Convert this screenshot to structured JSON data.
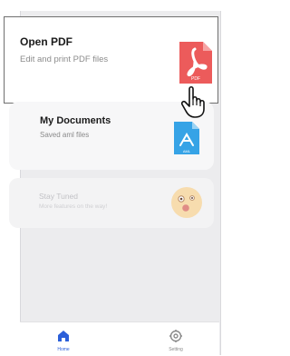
{
  "cards": {
    "open_pdf": {
      "title": "Open PDF",
      "subtitle": "Edit and print PDF files",
      "icon": "pdf-file-icon",
      "badge": "PDF"
    },
    "my_documents": {
      "title": "My Documents",
      "subtitle": "Saved aml files",
      "icon": "aml-file-icon",
      "badge": "AML"
    },
    "stay_tuned": {
      "title": "Stay Tuned",
      "subtitle": "More features on the way!",
      "icon": "surprised-face-icon"
    }
  },
  "nav": {
    "items": [
      {
        "label": "Home",
        "icon": "home-icon",
        "active": true
      },
      {
        "label": "Setting",
        "icon": "gear-icon",
        "active": false
      }
    ]
  },
  "colors": {
    "accent": "#2b5fd9",
    "pdf_red": "#ec5b5b",
    "aml_blue": "#36a3e6",
    "emoji_yellow": "#f7dcae",
    "screen_bg": "#ececee"
  },
  "cursor": "hand-pointer-icon"
}
